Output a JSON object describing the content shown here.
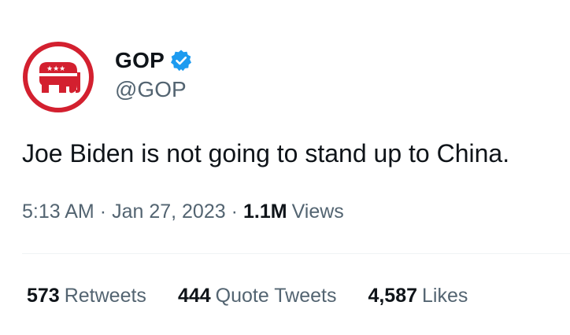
{
  "author": {
    "name": "GOP",
    "handle": "@GOP",
    "avatar_color": "#d3202f",
    "verified_color": "#1d9bf0"
  },
  "tweet": {
    "text": "Joe Biden is not going to stand up to China."
  },
  "meta": {
    "time": "5:13 AM",
    "separator": "·",
    "date": "Jan 27, 2023",
    "views_count": "1.1M",
    "views_label": "Views"
  },
  "stats": {
    "retweets_count": "573",
    "retweets_label": "Retweets",
    "quotes_count": "444",
    "quotes_label": "Quote Tweets",
    "likes_count": "4,587",
    "likes_label": "Likes"
  },
  "icons": {
    "avatar": "gop-elephant-logo",
    "verified": "verified-badge-icon"
  }
}
